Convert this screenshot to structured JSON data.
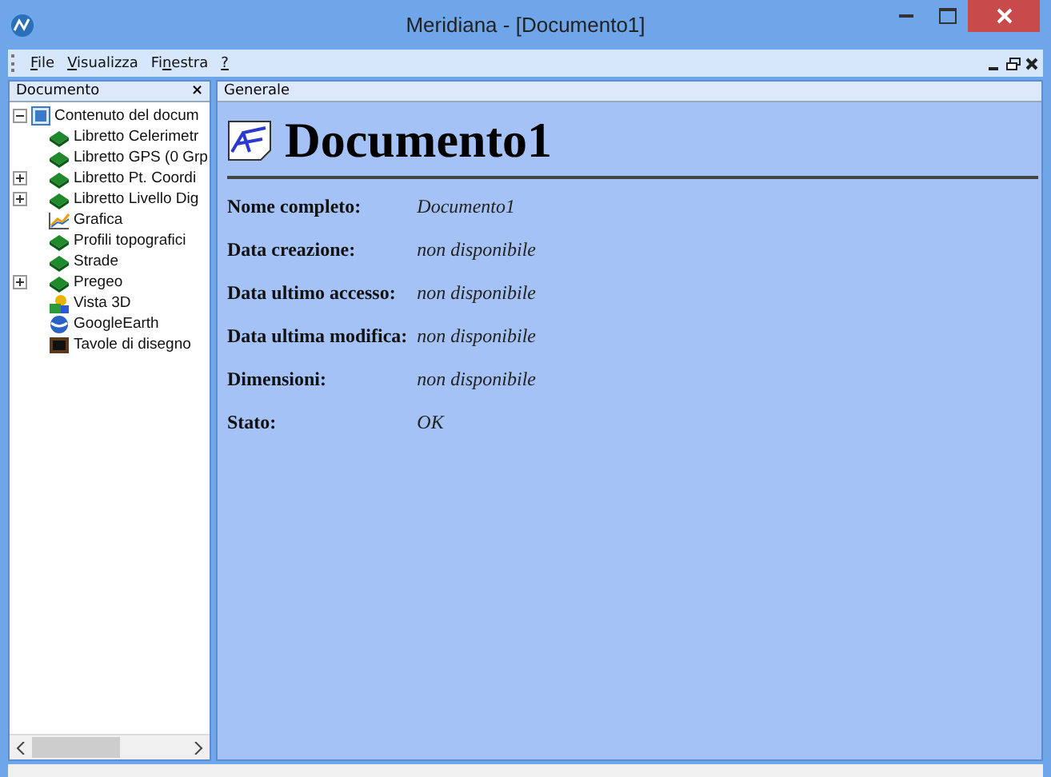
{
  "window": {
    "title": "Meridiana - [Documento1]"
  },
  "menu": [
    {
      "key": "F",
      "after": "ile"
    },
    {
      "key": "V",
      "after": "isualizza"
    },
    {
      "before": "Fi",
      "key": "n",
      "after": "estra"
    },
    {
      "key": "?"
    }
  ],
  "sidebar": {
    "title": "Documento",
    "close": "×",
    "tree": [
      {
        "label": "Contenuto del docum",
        "kind": "root",
        "expanded": true,
        "children": [
          {
            "label": "Libretto Celerimetr",
            "kind": "libretto"
          },
          {
            "label": "Libretto GPS (0 Grp",
            "kind": "libretto"
          },
          {
            "label": "Libretto Pt. Coordi",
            "kind": "libretto",
            "expanded": false
          },
          {
            "label": "Libretto Livello Dig",
            "kind": "libretto",
            "expanded": false
          },
          {
            "label": "Grafica",
            "kind": "chart"
          },
          {
            "label": "Profili topografici",
            "kind": "libretto"
          },
          {
            "label": "Strade",
            "kind": "libretto"
          },
          {
            "label": "Pregeo",
            "kind": "libretto",
            "expanded": false
          },
          {
            "label": "Vista 3D",
            "kind": "view3d"
          },
          {
            "label": "GoogleEarth",
            "kind": "globe"
          },
          {
            "label": "Tavole di disegno",
            "kind": "board"
          }
        ]
      }
    ]
  },
  "document": {
    "tab": "Generale",
    "title": "Documento1",
    "properties": [
      {
        "label": "Nome completo:",
        "value": "Documento1"
      },
      {
        "label": "Data creazione:",
        "value": "non disponibile"
      },
      {
        "label": "Data ultimo accesso:",
        "value": "non disponibile"
      },
      {
        "label": "Data ultima modifica:",
        "value": "non disponibile"
      },
      {
        "label": "Dimensioni:",
        "value": "non disponibile"
      },
      {
        "label": "Stato:",
        "value": "OK"
      }
    ]
  }
}
